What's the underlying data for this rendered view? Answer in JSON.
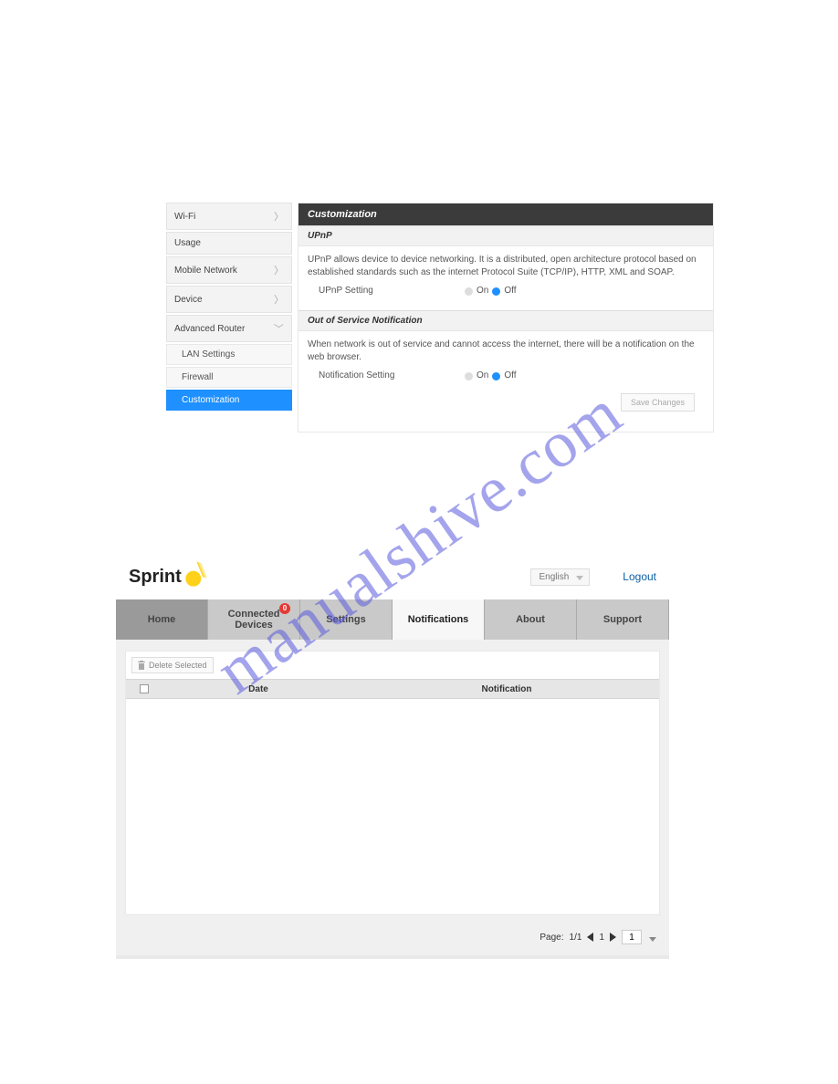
{
  "watermark": "manualshive.com",
  "panel1": {
    "sidebar": {
      "items": [
        {
          "label": "Wi-Fi",
          "chev": true
        },
        {
          "label": "Usage",
          "chev": false
        },
        {
          "label": "Mobile Network",
          "chev": true
        },
        {
          "label": "Device",
          "chev": true
        },
        {
          "label": "Advanced Router",
          "chev": true,
          "open": true
        }
      ],
      "subitems": [
        {
          "label": "LAN Settings"
        },
        {
          "label": "Firewall"
        },
        {
          "label": "Customization",
          "active": true
        }
      ]
    },
    "title": "Customization",
    "upnp": {
      "heading": "UPnP",
      "desc": "UPnP allows device to device networking. It is a distributed, open architecture protocol based on established standards such as the internet Protocol Suite (TCP/IP), HTTP, XML and SOAP.",
      "settingLabel": "UPnP Setting",
      "onLabel": "On",
      "offLabel": "Off",
      "value": "Off"
    },
    "oos": {
      "heading": "Out of Service Notification",
      "desc": "When network is out of service and cannot access the internet, there will be a notification on the web browser.",
      "settingLabel": "Notification Setting",
      "onLabel": "On",
      "offLabel": "Off",
      "value": "Off"
    },
    "saveLabel": "Save Changes"
  },
  "panel2": {
    "brand": "Sprint",
    "language": "English",
    "logout": "Logout",
    "tabs": [
      {
        "label": "Home"
      },
      {
        "label": "Connected\nDevices",
        "badge": "0"
      },
      {
        "label": "Settings"
      },
      {
        "label": "Notifications",
        "active": true
      },
      {
        "label": "About"
      },
      {
        "label": "Support"
      }
    ],
    "deleteLabel": "Delete Selected",
    "columns": {
      "date": "Date",
      "notification": "Notification"
    },
    "pager": {
      "label": "Page:",
      "pages": "1/1",
      "current": "1",
      "total": "1"
    }
  }
}
